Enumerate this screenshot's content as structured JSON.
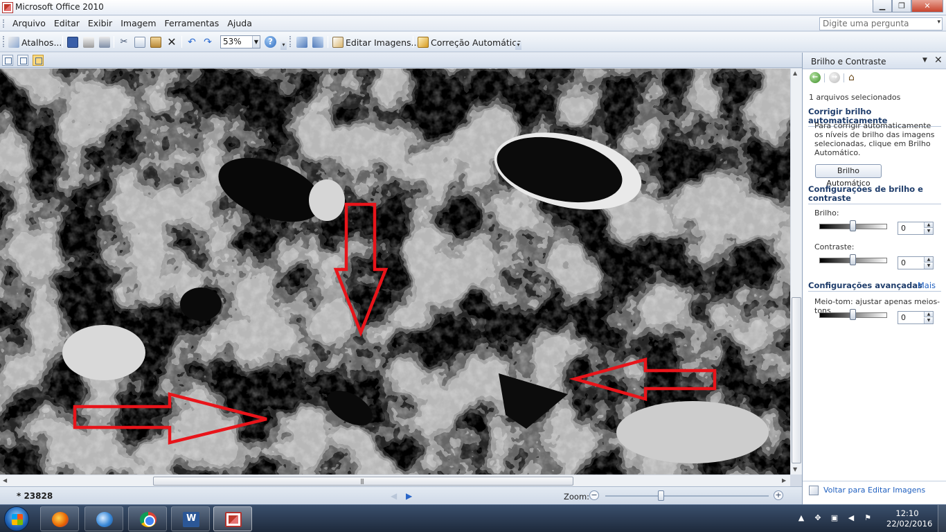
{
  "window": {
    "title": "Microsoft Office 2010",
    "buttons": {
      "minimize": "▁",
      "maximize": "❐",
      "close": "✕"
    }
  },
  "menu": {
    "items": [
      "Arquivo",
      "Editar",
      "Exibir",
      "Imagem",
      "Ferramentas",
      "Ajuda"
    ],
    "ask_placeholder": "Digite uma pergunta"
  },
  "toolbar": {
    "shortcuts_label": "Atalhos...",
    "zoom_value": "53%",
    "edit_images_label": "Editar Imagens...",
    "auto_correct_label": "Correção Automática",
    "icons": [
      "shortcuts-icon",
      "save-icon",
      "print-icon",
      "scan-icon",
      "cut-icon",
      "copy-icon",
      "paste-icon",
      "delete-icon",
      "undo-icon",
      "redo-icon",
      "help-icon",
      "rotate-left-icon",
      "rotate-right-icon",
      "edit-images-icon",
      "auto-correct-icon"
    ]
  },
  "statusbar": {
    "file_name": "* 23828",
    "zoom_label": "Zoom:",
    "zoom_level_fraction": 0.34
  },
  "taskpane": {
    "title": "Brilho e Contraste",
    "selected_text": "1 arquivos selecionados",
    "auto_section": "Corrigir brilho automaticamente",
    "auto_desc": "Para corrigir automaticamente os níveis de brilho das imagens selecionadas, clique em Brilho Automático.",
    "auto_button": "Brilho Automático",
    "settings_section": "Configurações de brilho e contraste",
    "brightness_label": "Brilho:",
    "brightness_value": "0",
    "contrast_label": "Contraste:",
    "contrast_value": "0",
    "advanced_section": "Configurações avançadas",
    "advanced_more": "Mais",
    "midtone_label": "Meio-tom: ajustar apenas meios-tons",
    "midtone_value": "0",
    "back_link": "Voltar para Editar Imagens"
  },
  "taskbar": {
    "apps": [
      "Firefox",
      "Google Earth",
      "Google Chrome",
      "Microsoft Word",
      "Microsoft Office Picture Manager"
    ],
    "time": "12:10",
    "date": "22/02/2016"
  },
  "colors": {
    "annotation_arrow": "#e8141a",
    "accent": "#1f5fbf"
  }
}
